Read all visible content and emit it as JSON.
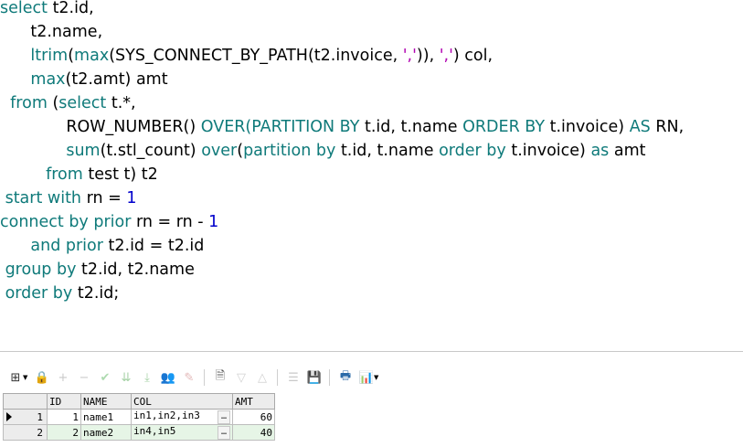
{
  "editor": {
    "lines": [
      [
        {
          "t": "select",
          "c": "kw"
        },
        {
          "t": " t2.id,",
          "c": "id"
        }
      ],
      [
        {
          "t": "      t2.name,",
          "c": "id"
        }
      ],
      [
        {
          "t": "      ",
          "c": "id"
        },
        {
          "t": "ltrim",
          "c": "kw"
        },
        {
          "t": "(",
          "c": "op"
        },
        {
          "t": "max",
          "c": "kw"
        },
        {
          "t": "(SYS_CONNECT_BY_PATH(t2.invoice, ",
          "c": "id"
        },
        {
          "t": "','",
          "c": "str"
        },
        {
          "t": ")), ",
          "c": "id"
        },
        {
          "t": "','",
          "c": "str"
        },
        {
          "t": ") col,",
          "c": "id"
        }
      ],
      [
        {
          "t": "      ",
          "c": "id"
        },
        {
          "t": "max",
          "c": "kw"
        },
        {
          "t": "(t2.amt) amt",
          "c": "id"
        }
      ],
      [
        {
          "t": "  ",
          "c": "id"
        },
        {
          "t": "from",
          "c": "kw"
        },
        {
          "t": " (",
          "c": "id"
        },
        {
          "t": "select",
          "c": "kw"
        },
        {
          "t": " t.*,",
          "c": "id"
        }
      ],
      [
        {
          "t": "             ROW_NUMBER() ",
          "c": "id"
        },
        {
          "t": "OVER(PARTITION BY",
          "c": "kw"
        },
        {
          "t": " t.id, t.name ",
          "c": "id"
        },
        {
          "t": "ORDER BY",
          "c": "kw"
        },
        {
          "t": " t.invoice) ",
          "c": "id"
        },
        {
          "t": "AS",
          "c": "kw"
        },
        {
          "t": " RN,",
          "c": "id"
        }
      ],
      [
        {
          "t": "             ",
          "c": "id"
        },
        {
          "t": "sum",
          "c": "kw"
        },
        {
          "t": "(t.stl_count) ",
          "c": "id"
        },
        {
          "t": "over",
          "c": "kw"
        },
        {
          "t": "(",
          "c": "id"
        },
        {
          "t": "partition by",
          "c": "kw"
        },
        {
          "t": " t.id, t.name ",
          "c": "id"
        },
        {
          "t": "order by",
          "c": "kw"
        },
        {
          "t": " t.invoice) ",
          "c": "id"
        },
        {
          "t": "as",
          "c": "kw"
        },
        {
          "t": " amt",
          "c": "id"
        }
      ],
      [
        {
          "t": "         ",
          "c": "id"
        },
        {
          "t": "from",
          "c": "kw"
        },
        {
          "t": " test t) t2",
          "c": "id"
        }
      ],
      [
        {
          "t": " ",
          "c": "id"
        },
        {
          "t": "start with",
          "c": "kw"
        },
        {
          "t": " rn = ",
          "c": "id"
        },
        {
          "t": "1",
          "c": "num"
        }
      ],
      [
        {
          "t": "connect by prior",
          "c": "kw"
        },
        {
          "t": " rn = rn - ",
          "c": "id"
        },
        {
          "t": "1",
          "c": "num"
        }
      ],
      [
        {
          "t": "      ",
          "c": "id"
        },
        {
          "t": "and prior",
          "c": "kw"
        },
        {
          "t": " t2.id = t2.id",
          "c": "id"
        }
      ],
      [
        {
          "t": " ",
          "c": "id"
        },
        {
          "t": "group by",
          "c": "kw"
        },
        {
          "t": " t2.id, t2.name",
          "c": "id"
        }
      ],
      [
        {
          "t": " ",
          "c": "id"
        },
        {
          "t": "order by",
          "c": "kw"
        },
        {
          "t": " t2.id;",
          "c": "id"
        }
      ]
    ]
  },
  "toolbar": {
    "buttons": [
      {
        "name": "grid-layout-icon",
        "glyph": "⊞",
        "enabled": true,
        "color": "#333333",
        "drop": true
      },
      {
        "name": "lock-icon",
        "glyph": "🔒",
        "enabled": true,
        "color": "#555555"
      },
      {
        "name": "add-record-icon",
        "glyph": "+",
        "enabled": false,
        "color": "#888888"
      },
      {
        "name": "delete-record-icon",
        "glyph": "−",
        "enabled": false,
        "color": "#888888"
      },
      {
        "name": "post-changes-icon",
        "glyph": "✔",
        "enabled": false,
        "color": "#4caf50"
      },
      {
        "name": "fetch-next-page-icon",
        "glyph": "⇊",
        "enabled": false,
        "color": "#3a9a3a"
      },
      {
        "name": "fetch-last-page-icon",
        "glyph": "⤓",
        "enabled": false,
        "color": "#3a9a3a"
      },
      {
        "name": "query-by-example-icon",
        "glyph": "👥",
        "enabled": true,
        "color": "#333333"
      },
      {
        "name": "clear-record-icon",
        "glyph": "✎",
        "enabled": false,
        "color": "#c06060"
      },
      {
        "name": "sep"
      },
      {
        "name": "single-record-view-icon",
        "glyph": "🗎",
        "enabled": true,
        "color": "#555555"
      },
      {
        "name": "next-record-icon",
        "glyph": "▽",
        "enabled": false,
        "color": "#999999"
      },
      {
        "name": "previous-record-icon",
        "glyph": "△",
        "enabled": false,
        "color": "#999999"
      },
      {
        "name": "sep"
      },
      {
        "name": "export-grid-icon",
        "glyph": "☰",
        "enabled": false,
        "color": "#888888"
      },
      {
        "name": "save-icon",
        "glyph": "💾",
        "enabled": true,
        "color": "#333366"
      },
      {
        "name": "sep"
      },
      {
        "name": "print-icon",
        "glyph": "🖶",
        "enabled": true,
        "color": "#2a6aa8"
      },
      {
        "name": "chart-icon",
        "glyph": "📊",
        "enabled": true,
        "color": "#aa2222",
        "drop": true
      }
    ]
  },
  "grid": {
    "columns": [
      "ID",
      "NAME",
      "COL",
      "AMT"
    ],
    "rows": [
      {
        "rownum": "1",
        "id": "1",
        "name": "name1",
        "col": "in1,in2,in3",
        "amt": "60",
        "current": true
      },
      {
        "rownum": "2",
        "id": "2",
        "name": "name2",
        "col": "in4,in5",
        "amt": "40",
        "current": false
      }
    ],
    "ellipsis": "…"
  }
}
